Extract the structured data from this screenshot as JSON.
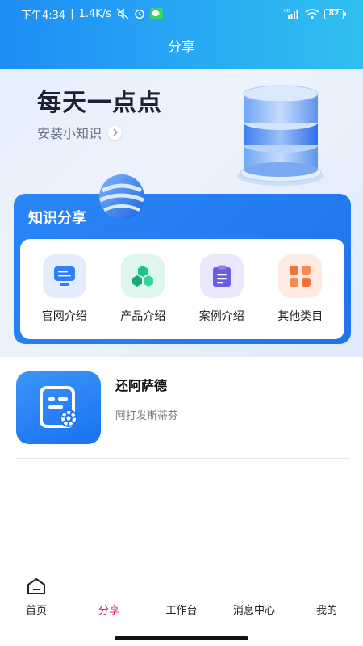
{
  "status_bar": {
    "time": "下午4:34",
    "speed": "1.4K/s",
    "separator": "|",
    "battery": "82",
    "hd_label": "HD"
  },
  "header": {
    "title": "分享"
  },
  "banner": {
    "title": "每天一点点",
    "subtitle": "安装小知识"
  },
  "knowledge": {
    "title": "知识分享",
    "items": [
      {
        "label": "官网介绍",
        "icon": "monitor-icon",
        "color": "#2f7ff5"
      },
      {
        "label": "产品介绍",
        "icon": "cubes-icon",
        "color": "#22c08a"
      },
      {
        "label": "案例介绍",
        "icon": "clipboard-icon",
        "color": "#6b5ce7"
      },
      {
        "label": "其他类目",
        "icon": "grid-icon",
        "color": "#f47238"
      }
    ]
  },
  "list": [
    {
      "title": "还阿萨德",
      "desc": "阿打发斯蒂芬",
      "icon": "document-gear-icon"
    }
  ],
  "bottom_nav": {
    "items": [
      {
        "label": "首页",
        "icon": "home-icon",
        "active": false
      },
      {
        "label": "分享",
        "active": true
      },
      {
        "label": "工作台",
        "active": false
      },
      {
        "label": "消息中心",
        "active": false
      },
      {
        "label": "我的",
        "active": false
      }
    ]
  },
  "colors": {
    "header_start": "#1e8cf5",
    "header_end": "#2fc0f0",
    "panel_blue": "#2a86f7",
    "active_nav": "#d81e5b"
  }
}
